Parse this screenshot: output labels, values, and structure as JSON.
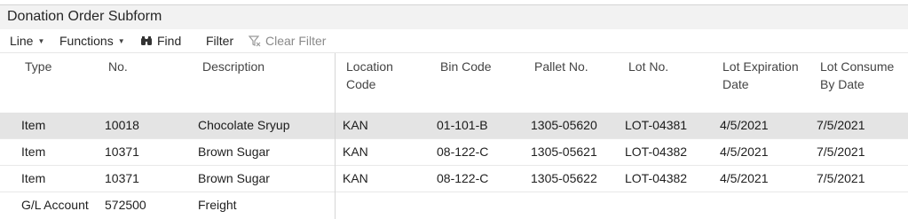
{
  "window": {
    "title": "Donation Order Subform"
  },
  "toolbar": {
    "line_label": "Line",
    "functions_label": "Functions",
    "find_label": "Find",
    "filter_label": "Filter",
    "clear_filter_label": "Clear Filter"
  },
  "table": {
    "headers": {
      "type": "Type",
      "no": "No.",
      "description": "Description",
      "location_code_1": "Location",
      "location_code_2": "Code",
      "bin_code": "Bin Code",
      "pallet_no": "Pallet No.",
      "lot_no": "Lot No.",
      "lot_expiration_1": "Lot Expiration",
      "lot_expiration_2": "Date",
      "lot_consume_1": "Lot Consume",
      "lot_consume_2": "By Date"
    },
    "rows": [
      {
        "type": "Item",
        "no": "10018",
        "description": "Chocolate Sryup",
        "location_code": "KAN",
        "bin_code": "01-101-B",
        "pallet_no": "1305-05620",
        "lot_no": "LOT-04381",
        "lot_expiration_date": "4/5/2021",
        "lot_consume_by_date": "7/5/2021"
      },
      {
        "type": "Item",
        "no": "10371",
        "description": "Brown Sugar",
        "location_code": "KAN",
        "bin_code": "08-122-C",
        "pallet_no": "1305-05621",
        "lot_no": "LOT-04382",
        "lot_expiration_date": "4/5/2021",
        "lot_consume_by_date": "7/5/2021"
      },
      {
        "type": "Item",
        "no": "10371",
        "description": "Brown Sugar",
        "location_code": "KAN",
        "bin_code": "08-122-C",
        "pallet_no": "1305-05622",
        "lot_no": "LOT-04382",
        "lot_expiration_date": "4/5/2021",
        "lot_consume_by_date": "7/5/2021"
      },
      {
        "type": "G/L Account",
        "no": "572500",
        "description": "Freight",
        "location_code": "",
        "bin_code": "",
        "pallet_no": "",
        "lot_no": "",
        "lot_expiration_date": "",
        "lot_consume_by_date": ""
      }
    ]
  },
  "icons": {
    "find": "binoculars-icon",
    "clear_filter": "clear-filter-icon",
    "caret": "caret-down-icon"
  }
}
